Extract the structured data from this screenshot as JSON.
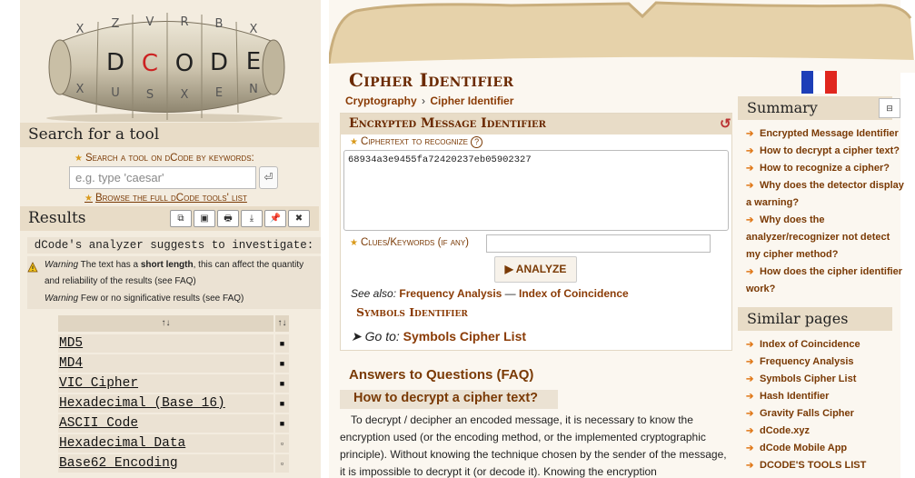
{
  "left": {
    "search_title": "Search for a tool",
    "search_by_keywords": "Search a tool on dCode by keywords:",
    "search_placeholder": "e.g. type 'caesar'",
    "go_label": "⏎",
    "browse_link": "Browse the full dCode tools' list",
    "results_title": "Results",
    "toolbar": [
      "⧉",
      "▣",
      "🖶",
      "⤓",
      "📌",
      "✖"
    ],
    "suggest": "dCode's analyzer suggests to investigate:",
    "warnings": [
      {
        "label": "Warning",
        "pre": "The text has a ",
        "bold": "short length",
        "post": ", this can affect the quantity and reliability of the results (see FAQ)"
      },
      {
        "label": "Warning",
        "pre": "Few or no significative results (see FAQ)",
        "bold": "",
        "post": ""
      }
    ],
    "table_headers": [
      "↑↓",
      "↑↓"
    ],
    "results": [
      {
        "name": "MD5",
        "mark": "■"
      },
      {
        "name": "MD4",
        "mark": "■"
      },
      {
        "name": "VIC Cipher",
        "mark": "■"
      },
      {
        "name": "Hexadecimal (Base 16)",
        "mark": "■"
      },
      {
        "name": "ASCII Code",
        "mark": "■"
      },
      {
        "name": "Hexadecimal Data",
        "mark": "▫"
      },
      {
        "name": "Base62 Encoding",
        "mark": "▫"
      }
    ]
  },
  "logo": {
    "text": "DCODE",
    "colors": [
      "#222222",
      "#cc2222"
    ]
  },
  "main": {
    "title": "Cipher Identifier",
    "breadcrumbs": [
      "Cryptography",
      "›",
      "Cipher Identifier"
    ],
    "panel_title": "Encrypted Message Identifier",
    "refresh_icon": "↺",
    "ciphertext_label": "Ciphertext to recognize",
    "help_icon": "?",
    "ciphertext_value": "68934a3e9455fa72420237eb05902327",
    "clues_label": "Clues/Keywords (if any)",
    "clues_value": "",
    "analyze_label": "▶ ANALYZE",
    "see_also_label": "See also:",
    "see_also_links": [
      "Frequency Analysis",
      "—",
      "Index of Coincidence"
    ],
    "symbols_identifier": "Symbols Identifier",
    "goto_label": "Go to:",
    "goto_link": "Symbols Cipher List",
    "faq_title": "Answers to Questions (FAQ)",
    "faq_question": "How to decrypt a cipher text?",
    "faq_answer": "To decrypt / decipher an encoded message, it is necessary to know the encryption used (or the encoding method, or the implemented cryptographic principle). Without knowing the technique chosen by the sender of the message, it is impossible to decrypt it (or decode it). Knowing the encryption"
  },
  "sidebar": {
    "summary_title": "Summary",
    "collapse_label": "⊟",
    "summary_items": [
      "Encrypted Message Identifier",
      "How to decrypt a cipher text?",
      "How to recognize a cipher?",
      "Why does the detector display a warning?",
      "Why does the analyzer/recognizer not detect my cipher method?",
      "How does the cipher identifier work?"
    ],
    "similar_title": "Similar pages",
    "similar_items": [
      "Index of Coincidence",
      "Frequency Analysis",
      "Symbols Cipher List",
      "Hash Identifier",
      "Gravity Falls Cipher",
      "dCode.xyz",
      "dCode Mobile App",
      "DCODE'S TOOLS LIST"
    ]
  },
  "colors": {
    "accent": "#7a3a05",
    "flag_blue": "#1d3fb8",
    "flag_white": "#ffffff",
    "flag_red": "#e0271f"
  }
}
